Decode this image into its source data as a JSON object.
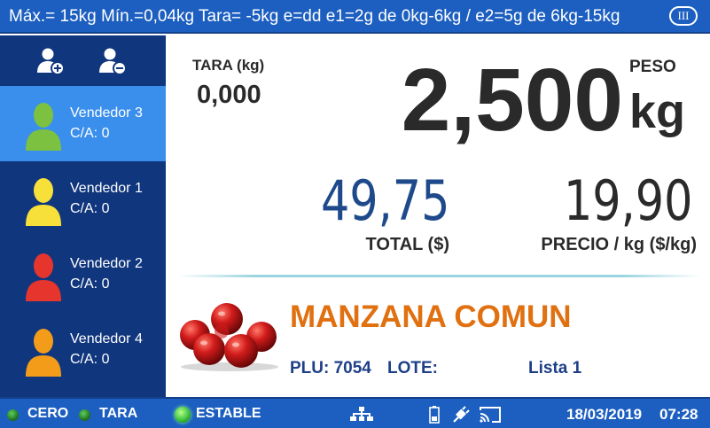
{
  "header": {
    "spec_line": "Máx.= 15kg  Mín.=0,04kg  Tara= -5kg  e=dd  e1=2g de 0kg-6kg / e2=5g de 6kg-15kg",
    "accuracy_class": "III"
  },
  "sidebar": {
    "tools": [
      {
        "icon": "add-user-icon"
      },
      {
        "icon": "remove-user-icon"
      }
    ],
    "sellers": [
      {
        "name": "Vendedor 3",
        "ca": "C/A: 0",
        "color": "#7cc140",
        "active": true
      },
      {
        "name": "Vendedor 1",
        "ca": "C/A: 0",
        "color": "#f7e03a",
        "active": false
      },
      {
        "name": "Vendedor 2",
        "ca": "C/A: 0",
        "color": "#e5352d",
        "active": false
      },
      {
        "name": "Vendedor 4",
        "ca": "C/A: 0",
        "color": "#f39c1a",
        "active": false
      }
    ]
  },
  "tare": {
    "label": "TARA (kg)",
    "value": "0,000"
  },
  "weight": {
    "label": "PESO",
    "value": "2,500",
    "unit": "kg"
  },
  "total": {
    "value": "49,75",
    "label": "TOTAL ($)"
  },
  "price": {
    "value": "19,90",
    "label": "PRECIO / kg ($/kg)"
  },
  "product": {
    "name": "MANZANA COMUN",
    "plu": "PLU: 7054",
    "lote": "LOTE:",
    "lista": "Lista 1",
    "image_icon": "apples-icon"
  },
  "status": {
    "zero_label": "CERO",
    "tare_label": "TARA",
    "stable_label": "ESTABLE",
    "date": "18/03/2019",
    "time": "07:28",
    "icons": [
      "network-icon",
      "battery-icon",
      "power-plug-icon",
      "cast-icon"
    ]
  },
  "colors": {
    "bar_blue": "#1c5fc0",
    "sidebar_navy": "#10367e",
    "active_seller": "#3a8fec",
    "product_orange": "#e07010",
    "total_blue": "#1e4a8c",
    "led_green": "#3fc43f"
  }
}
